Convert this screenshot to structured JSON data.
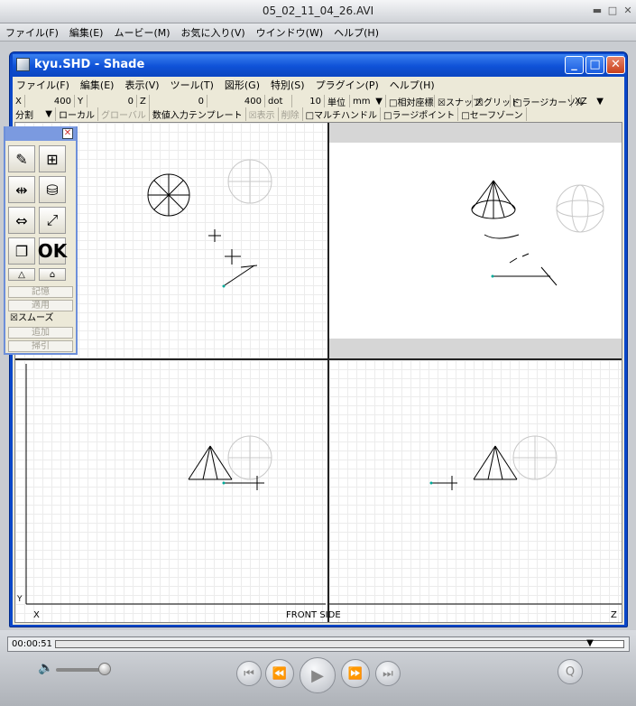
{
  "outer": {
    "title": "05_02_11_04_26.AVI",
    "menu": [
      "ファイル(F)",
      "編集(E)",
      "ムービー(M)",
      "お気に入り(V)",
      "ウインドウ(W)",
      "ヘルプ(H)"
    ]
  },
  "window": {
    "title": "kyu.SHD - Shade",
    "menu": [
      "ファイル(F)",
      "編集(E)",
      "表示(V)",
      "ツール(T)",
      "図形(G)",
      "特別(S)",
      "プラグイン(P)",
      "ヘルプ(H)"
    ]
  },
  "coords": {
    "x_label": "X",
    "x_value": "400",
    "y_label": "Y",
    "y_value": "0",
    "z_label": "Z",
    "z_value": "0",
    "dot_value": "400",
    "dot_label": "dot",
    "unit_num": "10",
    "unit_label": "単位",
    "unit_value": "mm",
    "relative": "□相対座標",
    "snap": "☒スナップ",
    "grid": "☒グリッド",
    "large_cursor": "□ラージカーソル",
    "plane": "XZ"
  },
  "modes": {
    "split": "分割",
    "local": "ローカル",
    "global": "グローバル",
    "numeric_template": "数値入力テンプレート",
    "show": "☒表示",
    "delete": "削除",
    "multi_handle": "□マルチハンドル",
    "large_point": "□ラージポイント",
    "safe_zone": "□セーフゾーン"
  },
  "palette": {
    "ok": "OK",
    "buttons": [
      "記憶",
      "適用"
    ],
    "smooth": "☒スムーズ",
    "buttons2": [
      "追加",
      "掃引"
    ]
  },
  "views": {
    "front_side": "FRONT SIDE",
    "x_axis": "X",
    "z_axis": "Z",
    "y_axis": "Y"
  },
  "player": {
    "time": "00:00:51",
    "progress": 0.94,
    "volume": 0.9
  }
}
